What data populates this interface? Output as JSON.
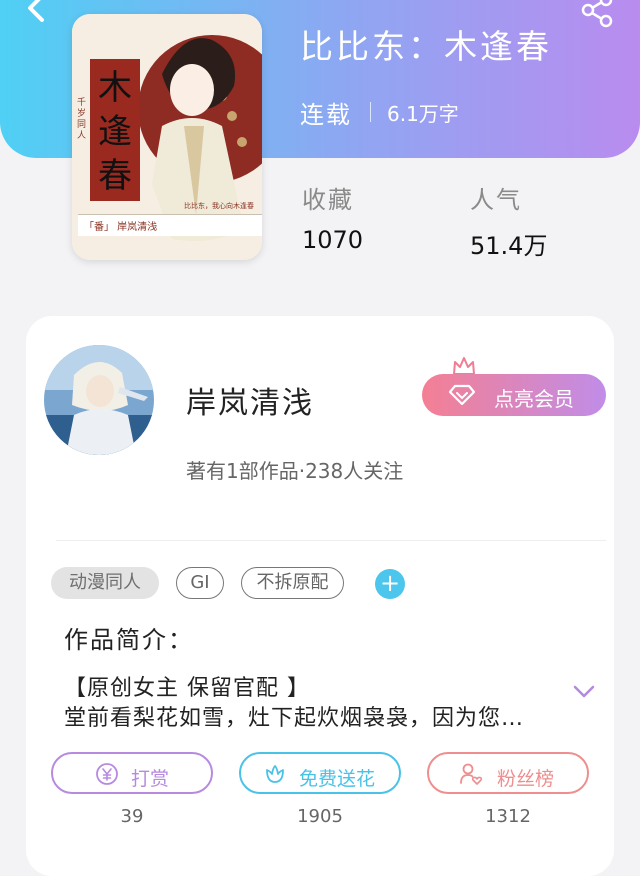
{
  "header": {
    "book_title": "比比东：木逢春",
    "status": "连载",
    "word_count": "6.1万字"
  },
  "cover": {
    "title_chars": [
      "木",
      "逢",
      "春"
    ],
    "side_text": "千岁同人",
    "bottom_text": "「番」 岸岚清浅",
    "caption_text": "比比东，我心向木逢春"
  },
  "stats": [
    {
      "label": "收藏",
      "value": "1070"
    },
    {
      "label": "人气",
      "value": "51.4万"
    }
  ],
  "author": {
    "name": "岸岚清浅",
    "meta": "著有1部作品·238人关注",
    "vip_label": "点亮会员"
  },
  "tags": [
    "动漫同人",
    "GI",
    "不拆原配"
  ],
  "tag_add": "+",
  "intro": {
    "heading": "作品简介：",
    "line1": "【原创女主 保留官配 】",
    "line2": "堂前看梨花如雪，灶下起炊烟袅袅，因为您…"
  },
  "actions": [
    {
      "label": "打赏",
      "count": "39",
      "color": "#b78ae0",
      "icon": "yen-coin-icon"
    },
    {
      "label": "免费送花",
      "count": "1905",
      "color": "#49c2e8",
      "icon": "flower-icon"
    },
    {
      "label": "粉丝榜",
      "count": "1312",
      "color": "#ee8e8e",
      "icon": "fans-ranking-icon"
    }
  ]
}
